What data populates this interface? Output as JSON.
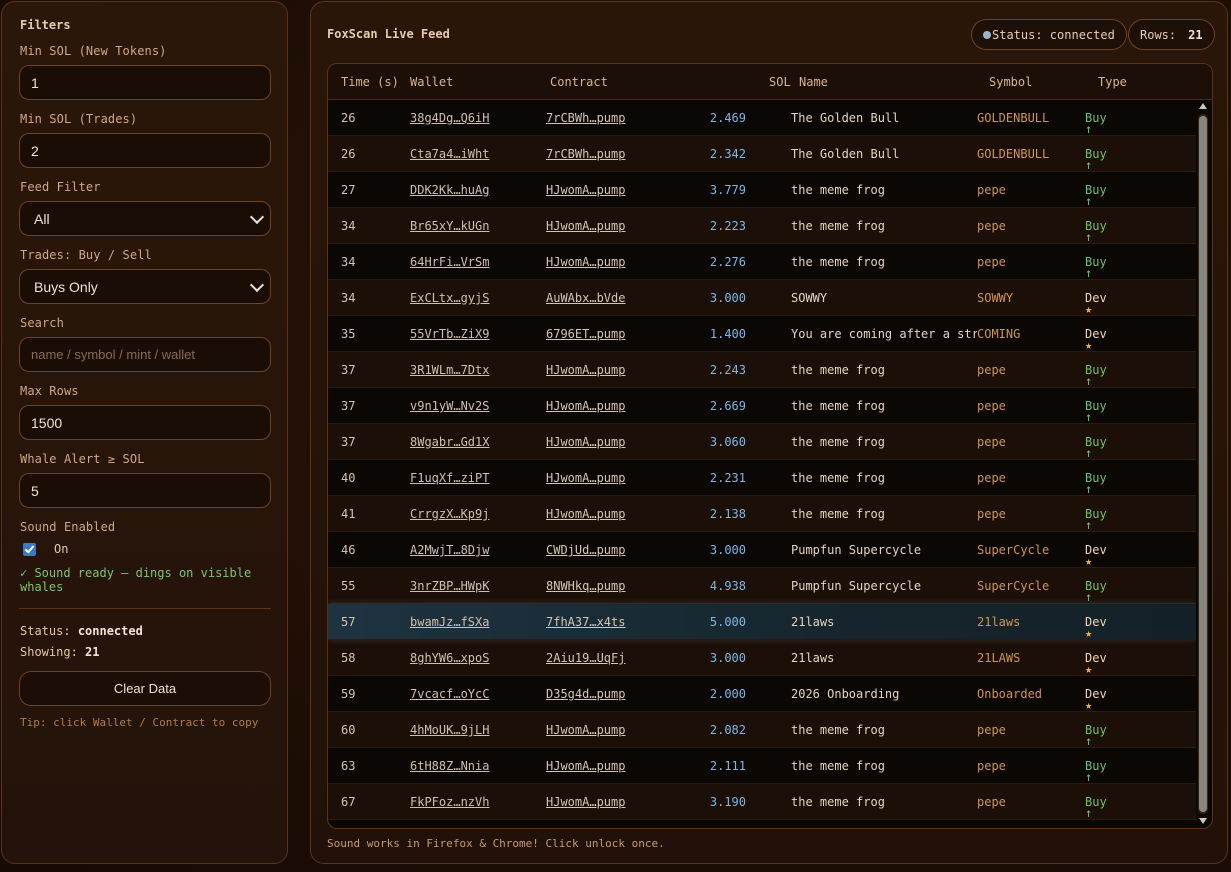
{
  "sidebar": {
    "title": "Filters",
    "min_sol_new_label": "Min SOL (New Tokens)",
    "min_sol_new_value": "1",
    "min_sol_trades_label": "Min SOL (Trades)",
    "min_sol_trades_value": "2",
    "feed_filter_label": "Feed Filter",
    "feed_filter_value": "All",
    "trades_label": "Trades: Buy / Sell",
    "trades_value": "Buys Only",
    "search_label": "Search",
    "search_placeholder": "name / symbol / mint / wallet",
    "max_rows_label": "Max Rows",
    "max_rows_value": "1500",
    "whale_label": "Whale Alert ≥ SOL",
    "whale_value": "5",
    "sound_label": "Sound Enabled",
    "sound_toggle": "On",
    "sound_msg": "✓ Sound ready — dings on visible whales",
    "status_prefix": "Status:",
    "status_value": "connected",
    "showing_prefix": "Showing:",
    "showing_value": "21",
    "clear_button": "Clear Data",
    "tip": "Tip: click Wallet / Contract to copy"
  },
  "main": {
    "title": "FoxScan Live Feed",
    "status_pill": "Status: connected",
    "rows_label": "Rows:",
    "rows_value": "21",
    "footer": "Sound works in Firefox & Chrome! Click unlock once.",
    "columns": [
      "Time (s)",
      "Wallet",
      "Contract",
      "SOL",
      "Name",
      "Symbol",
      "Type"
    ],
    "rows": [
      {
        "time": "26",
        "wallet": "38g4Dg…Q6iH",
        "contract": "7rCBWh…pump",
        "sol": "2.469",
        "name": "The Golden Bull",
        "symbol": "GOLDENBULL",
        "type": "Buy",
        "kind": "buy"
      },
      {
        "time": "26",
        "wallet": "Cta7a4…iWht",
        "contract": "7rCBWh…pump",
        "sol": "2.342",
        "name": "The Golden Bull",
        "symbol": "GOLDENBULL",
        "type": "Buy",
        "kind": "buy"
      },
      {
        "time": "27",
        "wallet": "DDK2Kk…huAg",
        "contract": "HJwomA…pump",
        "sol": "3.779",
        "name": "the meme frog",
        "symbol": "pepe",
        "type": "Buy",
        "kind": "buy"
      },
      {
        "time": "34",
        "wallet": "Br65xY…kUGn",
        "contract": "HJwomA…pump",
        "sol": "2.223",
        "name": "the meme frog",
        "symbol": "pepe",
        "type": "Buy",
        "kind": "buy"
      },
      {
        "time": "34",
        "wallet": "64HrFi…VrSm",
        "contract": "HJwomA…pump",
        "sol": "2.276",
        "name": "the meme frog",
        "symbol": "pepe",
        "type": "Buy",
        "kind": "buy"
      },
      {
        "time": "34",
        "wallet": "ExCLtx…gyjS",
        "contract": "AuWAbx…bVde",
        "sol": "3.000",
        "name": "SOWWY",
        "symbol": "SOWWY",
        "type": "Dev",
        "kind": "dev"
      },
      {
        "time": "35",
        "wallet": "55VrTb…ZiX9",
        "contract": "6796ET…pump",
        "sol": "1.400",
        "name": "You are coming after a struggle",
        "symbol": "COMING",
        "type": "Dev",
        "kind": "dev"
      },
      {
        "time": "37",
        "wallet": "3R1WLm…7Dtx",
        "contract": "HJwomA…pump",
        "sol": "2.243",
        "name": "the meme frog",
        "symbol": "pepe",
        "type": "Buy",
        "kind": "buy"
      },
      {
        "time": "37",
        "wallet": "v9n1yW…Nv2S",
        "contract": "HJwomA…pump",
        "sol": "2.669",
        "name": "the meme frog",
        "symbol": "pepe",
        "type": "Buy",
        "kind": "buy"
      },
      {
        "time": "37",
        "wallet": "8Wgabr…Gd1X",
        "contract": "HJwomA…pump",
        "sol": "3.060",
        "name": "the meme frog",
        "symbol": "pepe",
        "type": "Buy",
        "kind": "buy"
      },
      {
        "time": "40",
        "wallet": "F1uqXf…ziPT",
        "contract": "HJwomA…pump",
        "sol": "2.231",
        "name": "the meme frog",
        "symbol": "pepe",
        "type": "Buy",
        "kind": "buy"
      },
      {
        "time": "41",
        "wallet": "CrrgzX…Kp9j",
        "contract": "HJwomA…pump",
        "sol": "2.138",
        "name": "the meme frog",
        "symbol": "pepe",
        "type": "Buy",
        "kind": "buy"
      },
      {
        "time": "46",
        "wallet": "A2MwjT…8Djw",
        "contract": "CWDjUd…pump",
        "sol": "3.000",
        "name": "Pumpfun Supercycle",
        "symbol": "SuperCycle",
        "type": "Dev",
        "kind": "dev"
      },
      {
        "time": "55",
        "wallet": "3nrZBP…HWpK",
        "contract": "8NWHkq…pump",
        "sol": "4.938",
        "name": "Pumpfun Supercycle",
        "symbol": "SuperCycle",
        "type": "Buy",
        "kind": "buy"
      },
      {
        "time": "57",
        "wallet": "bwamJz…fSXa",
        "contract": "7fhA37…x4ts",
        "sol": "5.000",
        "name": "21laws",
        "symbol": "21laws",
        "type": "Dev",
        "kind": "dev"
      },
      {
        "time": "58",
        "wallet": "8ghYW6…xpoS",
        "contract": "2Aiu19…UqFj",
        "sol": "3.000",
        "name": "21laws",
        "symbol": "21LAWS",
        "type": "Dev",
        "kind": "dev"
      },
      {
        "time": "59",
        "wallet": "7vcacf…oYcC",
        "contract": "D35g4d…pump",
        "sol": "2.000",
        "name": "2026 Onboarding",
        "symbol": "Onboarded",
        "type": "Dev",
        "kind": "dev"
      },
      {
        "time": "60",
        "wallet": "4hMoUK…9jLH",
        "contract": "HJwomA…pump",
        "sol": "2.082",
        "name": "the meme frog",
        "symbol": "pepe",
        "type": "Buy",
        "kind": "buy"
      },
      {
        "time": "63",
        "wallet": "6tH88Z…Nnia",
        "contract": "HJwomA…pump",
        "sol": "2.111",
        "name": "the meme frog",
        "symbol": "pepe",
        "type": "Buy",
        "kind": "buy"
      },
      {
        "time": "67",
        "wallet": "FkPFoz…nzVh",
        "contract": "HJwomA…pump",
        "sol": "3.190",
        "name": "the meme frog",
        "symbol": "pepe",
        "type": "Buy",
        "kind": "buy"
      }
    ]
  },
  "colors": {
    "buy": "#6fc06a",
    "dev_star": "#f2b53c",
    "sol": "#7eb6e8",
    "symbol": "#d09552",
    "accent_border": "#6c4222"
  },
  "icons": {
    "buy": "arrow-up-icon",
    "dev": "star-icon",
    "checkbox": "checkbox-checked-icon",
    "select": "chevron-down-icon",
    "status": "status-dot-icon"
  }
}
